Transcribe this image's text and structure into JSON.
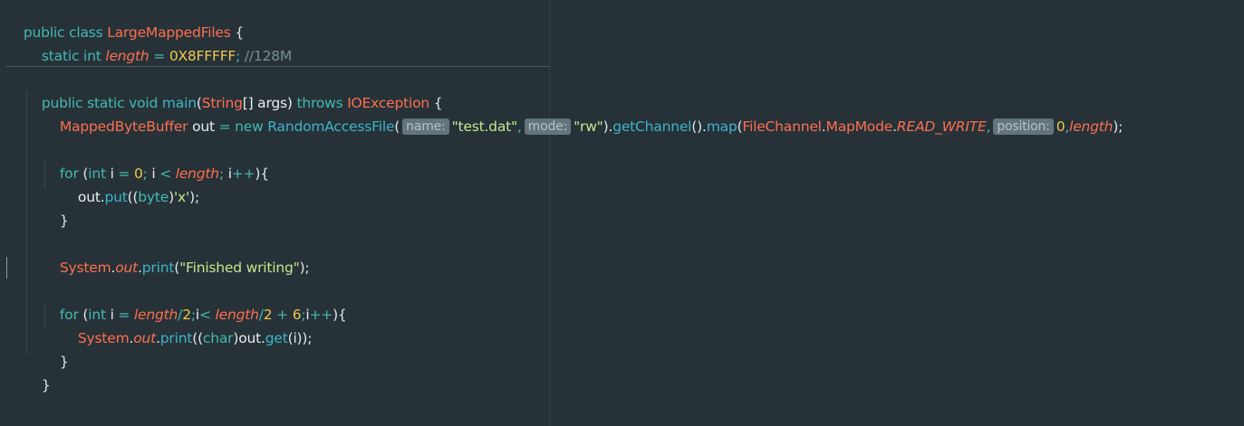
{
  "editor": {
    "language": "Java",
    "theme_background": "#263238",
    "lines": {
      "l1": {
        "kw": "public class ",
        "cls": "LargeMappedFiles",
        "rest": " {"
      },
      "l2": {
        "kw": "static int ",
        "fld": "length",
        "eq": " = ",
        "num": "0X8FFFFF",
        "semi": "; ",
        "comment": "//128M"
      },
      "l3": {
        "kw": "public static void ",
        "fn": "main",
        "p1": "(",
        "cls": "String",
        "p2": "[] args) ",
        "throws": "throws ",
        "exc": "IOException",
        "p3": " {"
      },
      "l4": {
        "cls1": "MappedByteBuffer",
        "out": " out ",
        "eq": "= ",
        "new": "new ",
        "cls2": "RandomAccessFile",
        "p1": "(",
        "hint_name": "name:",
        "str1": "\"test.dat\"",
        "comma1": ",",
        "hint_mode": "mode:",
        "str2": "\"rw\"",
        "p2": ").",
        "getChannel": "getChannel",
        "p3": "().",
        "map": "map",
        "p4": "(",
        "cls3": "FileChannel",
        "dot1": ".",
        "cls4": "MapMode",
        "dot2": ".",
        "fld1": "READ_WRITE",
        "comma2": ",",
        "hint_position": "position:",
        "num": "0",
        "comma3": ",",
        "fld2": "length",
        "p5": ");"
      },
      "l5": {
        "kw": "for ",
        "p1": "(",
        "kw2": "int ",
        "i1": "i ",
        "eq": "= ",
        "num": "0",
        "s1": "; ",
        "i2": "i ",
        "lt": "< ",
        "fld": "length",
        "s2": "; ",
        "i3": "i",
        "inc": "++",
        "p2": "){"
      },
      "l6": {
        "out": "out",
        "dot": ".",
        "fn": "put",
        "p1": "((",
        "kw": "byte",
        "p2": ")",
        "str": "'x'",
        "p3": ");"
      },
      "l7": {
        "brace": "}"
      },
      "l8": {
        "cls": "System",
        "dot1": ".",
        "fld": "out",
        "dot2": ".",
        "fn": "print",
        "p1": "(",
        "str": "\"Finished writing\"",
        "p2": ");"
      },
      "l9": {
        "kw": "for ",
        "p1": "(",
        "kw2": "int ",
        "i1": "i ",
        "eq": "= ",
        "fld1": "length",
        "div": "/",
        "num1": "2",
        "s1": ";",
        "i2": "i",
        "lt": "< ",
        "fld2": "length",
        "div2": "/",
        "num2": "2",
        "plus": " + ",
        "num3": "6",
        "s2": ";",
        "i3": "i",
        "inc": "++",
        "p2": "){"
      },
      "l10": {
        "cls": "System",
        "dot1": ".",
        "fld": "out",
        "dot2": ".",
        "fn": "print",
        "p1": "((",
        "kw": "char",
        "p2": ")",
        "out": "out",
        "dot3": ".",
        "fn2": "get",
        "p3": "(i));"
      },
      "l11": {
        "brace": "}"
      },
      "l12": {
        "brace": "}"
      },
      "l13": {
        "brace": "}"
      }
    }
  }
}
